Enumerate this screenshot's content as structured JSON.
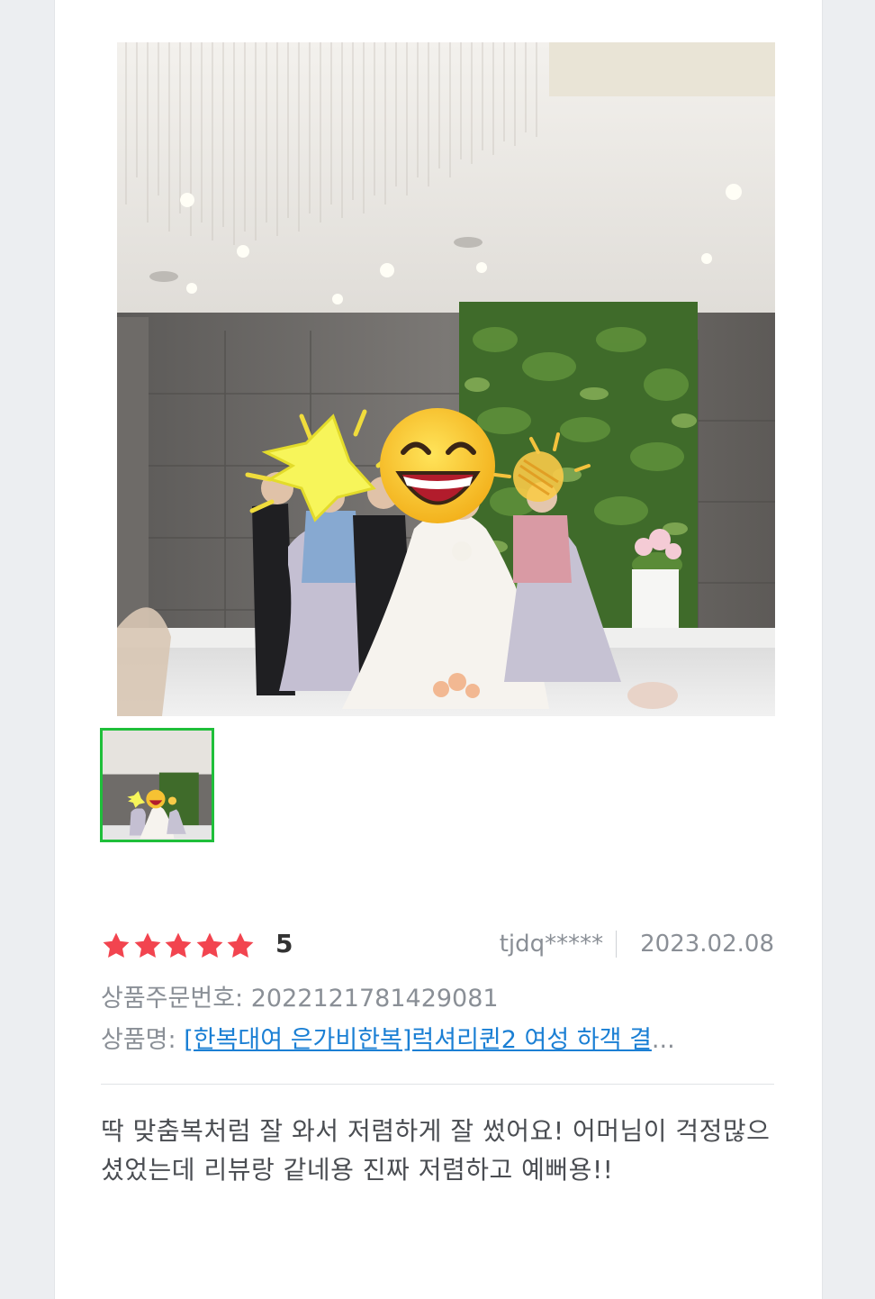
{
  "photo": {
    "main_alt": "wedding photo",
    "thumb_alt": "wedding photo thumbnail",
    "thumb_border_color": "#1fbf3a"
  },
  "rating": {
    "stars": 5,
    "score": "5",
    "star_color": "#f2444f"
  },
  "reviewer": {
    "id": "tjdq*****",
    "date": "2023.02.08"
  },
  "order": {
    "label": "상품주문번호:",
    "value": "2022121781429081"
  },
  "product": {
    "label": "상품명:",
    "link_text": "[한복대여 은가비한복]럭셔리퀸2 여성 하객 결",
    "ellipsis": "...",
    "link_color": "#1a7fd4"
  },
  "review": {
    "text": "딱 맞춤복처럼 잘 와서 저렴하게 잘 썼어요! 어머님이 걱정많으셨었는데 리뷰랑 같네용 진짜 저렴하고 예뻐용!!"
  }
}
